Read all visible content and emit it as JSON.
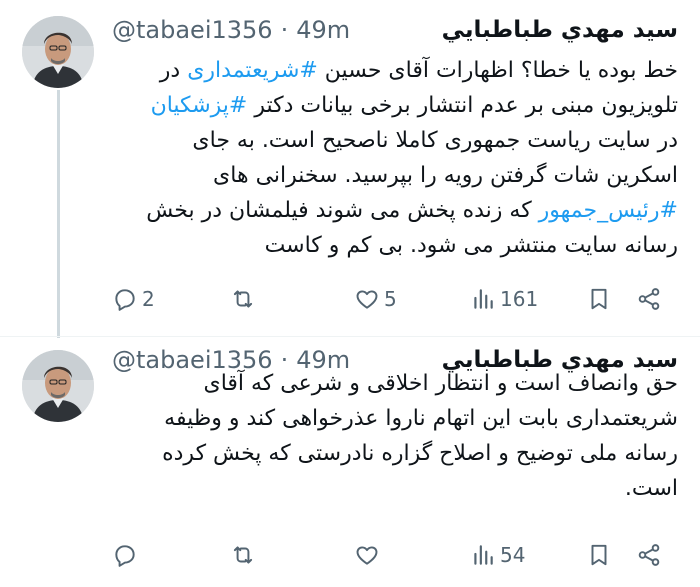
{
  "tweets": [
    {
      "author_name": "سيد مهدي طباطبايي",
      "handle": "@tabaei1356",
      "separator": "·",
      "time": "49m",
      "lines": [
        [
          {
            "t": "خط بوده یا خطا؟ اظهارات آقای حسین "
          },
          {
            "t": "#شریعتمداری",
            "h": true
          },
          {
            "t": " در"
          }
        ],
        [
          {
            "t": "تلویزیون مبنی بر عدم انتشار برخی بیانات دکتر "
          },
          {
            "t": "#پزشکیان",
            "h": true
          }
        ],
        [
          {
            "t": "در سایت ریاست جمهوری کاملا ناصحیح است. به جای"
          }
        ],
        [
          {
            "t": "اسکرین شات گرفتن رویه را بپرسید. سخنرانی های"
          }
        ],
        [
          {
            "t": "#رئیس_جمهور",
            "h": true
          },
          {
            "t": " که زنده پخش می شوند فیلمشان در بخش"
          }
        ],
        [
          {
            "t": "رسانه سایت منتشر می شود. بی کم و کاست"
          }
        ]
      ],
      "replies": "2",
      "retweets": "",
      "likes": "5",
      "views": "161"
    },
    {
      "author_name": "سيد مهدي طباطبايي",
      "handle": "@tabaei1356",
      "separator": "·",
      "time": "49m",
      "lines": [
        [
          {
            "t": "حق وانصاف است و انتظار اخلاقی و شرعی که آقای"
          }
        ],
        [
          {
            "t": "شریعتمداری بابت این اتهام ناروا عذرخواهی کند و وظیفه"
          }
        ],
        [
          {
            "t": "رسانه ملی توضیح و اصلاح گزاره نادرستی که پخش کرده"
          }
        ],
        [
          {
            "t": "است."
          }
        ]
      ],
      "replies": "",
      "retweets": "",
      "likes": "",
      "views": "54"
    }
  ],
  "icons": {
    "reply": "reply-icon",
    "retweet": "retweet-icon",
    "like": "heart-icon",
    "views": "views-icon",
    "bookmark": "bookmark-icon",
    "share": "share-icon"
  },
  "colors": {
    "hashtag": "#1d9bf0",
    "muted": "#536471",
    "text": "#0f1419",
    "thread_line": "#cfd9de"
  }
}
